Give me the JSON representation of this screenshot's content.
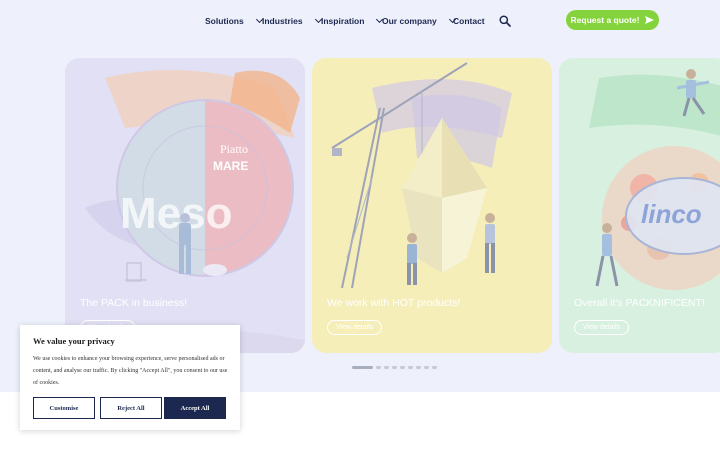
{
  "nav": {
    "items": [
      {
        "label": "Solutions",
        "dropdown": true
      },
      {
        "label": "Industries",
        "dropdown": true
      },
      {
        "label": "Inspiration",
        "dropdown": true
      },
      {
        "label": "Our company",
        "dropdown": true
      },
      {
        "label": "Contact",
        "dropdown": false
      }
    ],
    "search_icon": "search-icon",
    "quote_button": "Request a quote!",
    "quote_icon": "send-icon"
  },
  "slides": [
    {
      "title": "The PACK in business!",
      "link": "View details",
      "art_text_1": "Piatto",
      "art_text_2": "MARE",
      "art_text_big": "Meso"
    },
    {
      "title": "We work with HOT products!",
      "link": "View details"
    },
    {
      "title": "Overall it's PACKNIFICENT!",
      "link": "View details",
      "art_text_brand": "linco"
    }
  ],
  "pagination": {
    "count": 9,
    "active": 0
  },
  "cookie": {
    "title": "We value your privacy",
    "text": "We use cookies to enhance your browsing experience, serve personalised ads or content, and analyse our traffic. By clicking \"Accept All\", you consent to our use of cookies.",
    "customise": "Customise",
    "reject": "Reject All",
    "accept": "Accept All"
  },
  "colors": {
    "accent": "#84d33c",
    "navy": "#1d2850"
  }
}
